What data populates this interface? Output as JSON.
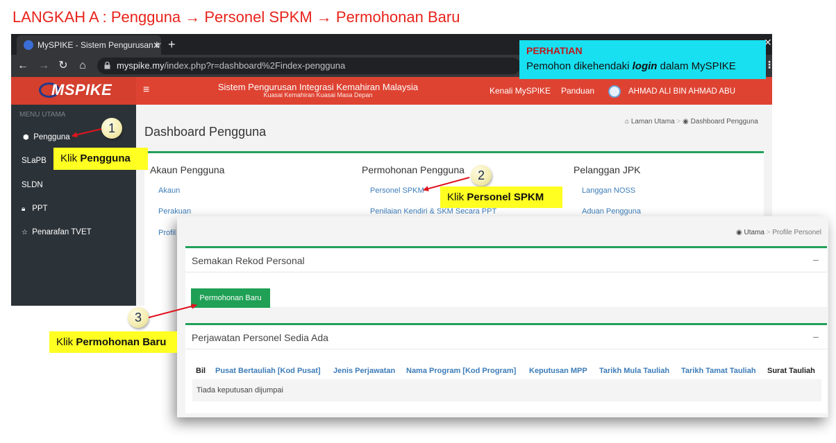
{
  "heading": "LANGKAH A : Pengguna → Personel SPKM → Permohonan Baru",
  "browser": {
    "tab_title": "MySPIKE - Sistem Pengurusan Int",
    "tab_close": "✕",
    "new_tab": "+",
    "url_domain": "myspike.my",
    "url_path": "/index.php?r=dashboard%2Findex-pengguna"
  },
  "app": {
    "logo": "MSPIKE",
    "site_title": "Sistem Pengurusan Integrasi Kemahiran Malaysia",
    "site_subtitle": "Kuasai Kemahiran Kuasai Masa Depan",
    "nav_kenali": "Kenali MySPIKE",
    "nav_panduan": "Panduan",
    "user_name": "AHMAD ALI BIN AHMAD ABU"
  },
  "sidebar": {
    "menu_label": "MENU UTAMA",
    "items": [
      {
        "label": "Pengguna",
        "icon": "user-icon"
      },
      {
        "label": "SLaPB",
        "icon": ""
      },
      {
        "label": "SLDN",
        "icon": ""
      },
      {
        "label": "PPT",
        "icon": "lock-icon"
      },
      {
        "label": "Penarafan TVET",
        "icon": "star-icon"
      }
    ]
  },
  "dashboard": {
    "title": "Dashboard Pengguna",
    "breadcrumb_home": "Laman Utama",
    "breadcrumb_current": "Dashboard Pengguna",
    "columns": [
      {
        "heading": "Akaun Pengguna",
        "links": [
          "Akaun",
          "Perakuan",
          "Profil"
        ]
      },
      {
        "heading": "Permohonan Pengguna",
        "links": [
          "Personel SPKM",
          "Penilaian Kendiri & SKM Secara PPT"
        ]
      },
      {
        "heading": "Pelanggan JPK",
        "links": [
          "Langgan NOSS",
          "Aduan Pengguna"
        ]
      }
    ]
  },
  "profile": {
    "breadcrumb_home": "Utama",
    "breadcrumb_current": "Profile Personel",
    "panel1_title": "Semakan Rekod Personal",
    "panel_minimize": "–",
    "new_button": "Permohonan Baru",
    "panel2_title": "Perjawatan Personel Sedia Ada",
    "table_headers": [
      "Bil",
      "Pusat Bertauliah [Kod Pusat]",
      "Jenis Perjawatan",
      "Nama Program [Kod Program]",
      "Keputusan MPP",
      "Tarikh Mula Tauliah",
      "Tarikh Tamat Tauliah",
      "Surat Tauliah"
    ],
    "empty_message": "Tiada keputusan dijumpai"
  },
  "notice": {
    "heading": "PERHATIAN",
    "text_before": "Pemohon dikehendaki ",
    "text_emph": "login",
    "text_after": " dalam MySPIKE"
  },
  "annotations": {
    "step1": "1",
    "step2": "2",
    "step3": "3",
    "call1_pre": "Klik ",
    "call1_bold": "Pengguna",
    "call2_pre": "Klik ",
    "call2_bold": "Personel SPKM",
    "call3_pre": "Klik ",
    "call3_bold": "Permohonan Baru"
  },
  "colors": {
    "heading_red": "#e8231b",
    "header_red": "#de4332",
    "accent_green": "#22a05a",
    "link_blue": "#3c7cb8",
    "callout_yellow": "#ffff22",
    "notice_cyan": "#18e0f0"
  }
}
